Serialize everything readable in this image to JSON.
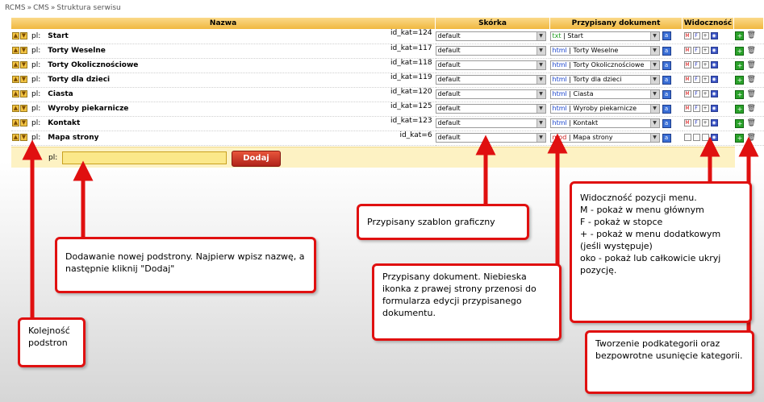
{
  "breadcrumb": [
    "RCMS",
    "CMS",
    "Struktura serwisu"
  ],
  "table": {
    "headers": {
      "name": "Nazwa",
      "skin": "Skórka",
      "doc": "Przypisany dokument",
      "vis": "Widoczność"
    },
    "rows": [
      {
        "lang": "pl:",
        "name": "Start",
        "id": "id_kat=124",
        "skin": "default",
        "doc_type": "txt",
        "doc_name": "Start",
        "vis": {
          "m": true,
          "f": true,
          "plus": true,
          "eye": true
        }
      },
      {
        "lang": "pl:",
        "name": "Torty Weselne",
        "id": "id_kat=117",
        "skin": "default",
        "doc_type": "html",
        "doc_name": "Torty Weselne",
        "vis": {
          "m": true,
          "f": true,
          "plus": true,
          "eye": true
        }
      },
      {
        "lang": "pl:",
        "name": "Torty Okolicznościowe",
        "id": "id_kat=118",
        "skin": "default",
        "doc_type": "html",
        "doc_name": "Torty Okolicznościowe",
        "vis": {
          "m": true,
          "f": true,
          "plus": true,
          "eye": true
        }
      },
      {
        "lang": "pl:",
        "name": "Torty dla dzieci",
        "id": "id_kat=119",
        "skin": "default",
        "doc_type": "html",
        "doc_name": "Torty dla dzieci",
        "vis": {
          "m": true,
          "f": true,
          "plus": true,
          "eye": true
        }
      },
      {
        "lang": "pl:",
        "name": "Ciasta",
        "id": "id_kat=120",
        "skin": "default",
        "doc_type": "html",
        "doc_name": "Ciasta",
        "vis": {
          "m": true,
          "f": true,
          "plus": true,
          "eye": true
        }
      },
      {
        "lang": "pl:",
        "name": "Wyroby piekarnicze",
        "id": "id_kat=125",
        "skin": "default",
        "doc_type": "html",
        "doc_name": "Wyroby piekarnicze",
        "vis": {
          "m": true,
          "f": true,
          "plus": true,
          "eye": true
        }
      },
      {
        "lang": "pl:",
        "name": "Kontakt",
        "id": "id_kat=123",
        "skin": "default",
        "doc_type": "html",
        "doc_name": "Kontakt",
        "vis": {
          "m": true,
          "f": true,
          "plus": true,
          "eye": true
        }
      },
      {
        "lang": "pl:",
        "name": "Mapa strony",
        "id": "id_kat=6",
        "skin": "default",
        "doc_type": "mod",
        "doc_name": "Mapa strony",
        "vis": {
          "m": false,
          "f": false,
          "plus": false,
          "eye": true
        }
      }
    ]
  },
  "add_row": {
    "lang": "pl:",
    "input_value": "",
    "button_label": "Dodaj"
  },
  "callouts": {
    "skin": "Przypisany szablon graficzny",
    "add": "Dodawanie nowej podstrony. Najpierw wpisz nazwę, a następnie kliknij \"Dodaj\"",
    "doc": "Przypisany dokument. Niebieska ikonka z prawej strony przenosi do formularza edycji przypisanego dokumentu.",
    "vis": [
      "Widoczność pozycji menu.",
      "M - pokaż w menu głównym",
      "F - pokaż w stopce",
      "+ - pokaż w menu dodatkowym (jeśli występuje)",
      "oko - pokaż lub całkowicie ukryj pozycję."
    ],
    "order": "Kolejność podstron",
    "sub": "Tworzenie podkategorii oraz bezpowrotne usunięcie kategorii."
  },
  "colors": {
    "accent_red": "#e01010",
    "header_orange": "#f0b840",
    "add_row_bg": "#fdf2c3"
  }
}
